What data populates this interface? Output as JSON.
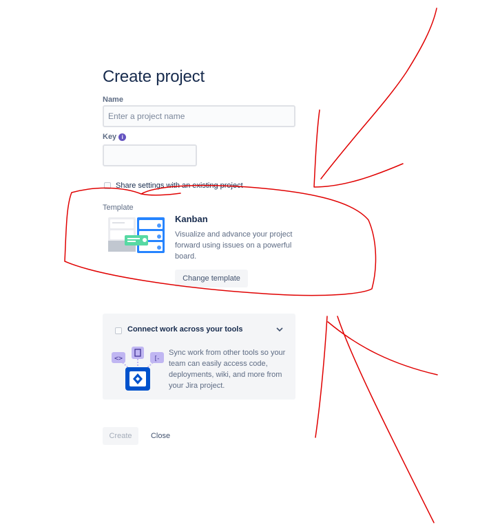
{
  "page": {
    "title": "Create project"
  },
  "form": {
    "name_label": "Name",
    "name_placeholder": "Enter a project name",
    "name_value": "",
    "key_label": "Key",
    "key_info_glyph": "i",
    "key_value": "",
    "share_label": "Share settings with an existing project",
    "share_checked": false
  },
  "template": {
    "label": "Template",
    "name": "Kanban",
    "description": "Visualize and advance your project forward using issues on a powerful board.",
    "change_button": "Change template"
  },
  "connect": {
    "title": "Connect work across your tools",
    "checked": false,
    "expand_icon": "chevron-down-icon",
    "description": "Sync work from other tools so your team can easily access code, deployments, wiki, and more from your Jira project."
  },
  "footer": {
    "create_button": "Create",
    "close_button": "Close"
  },
  "colors": {
    "annotation": "#e00000",
    "accent": "#0052cc",
    "info": "#6554c0"
  }
}
